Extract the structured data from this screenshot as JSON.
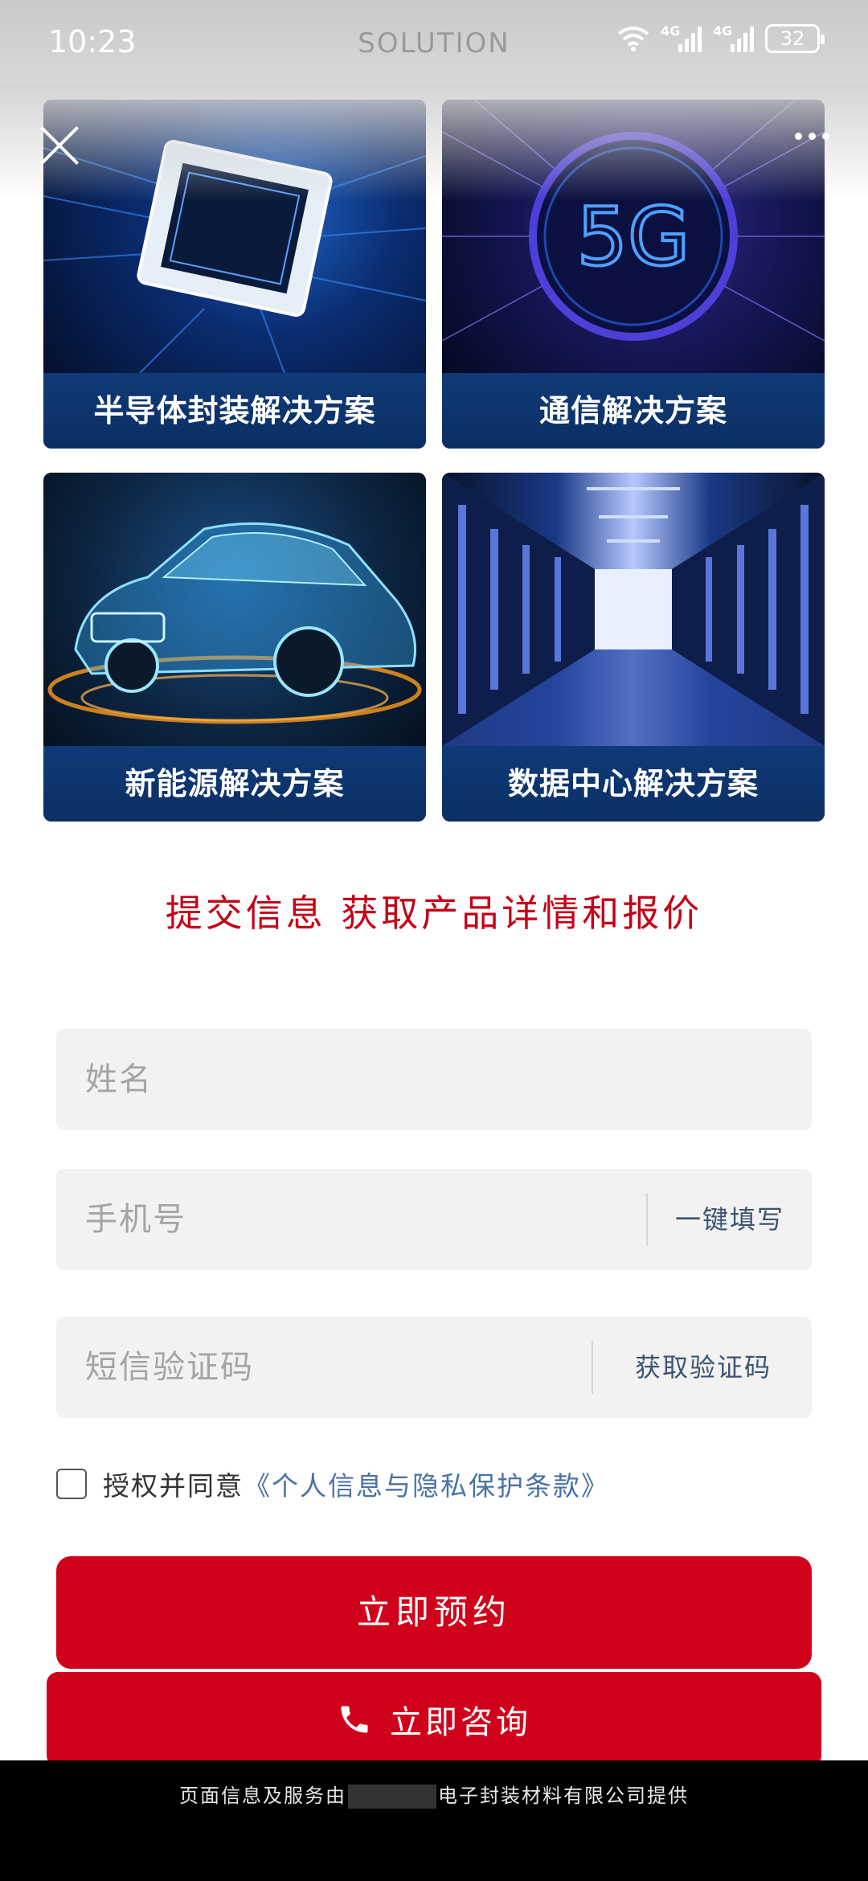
{
  "status_bar": {
    "time": "10:23",
    "center_text": "SOLUTION",
    "network_1": "4G",
    "network_2": "4G",
    "battery": "32"
  },
  "cards": [
    {
      "label": "半导体封装解决方案",
      "image": "semiconductor-chip-image"
    },
    {
      "label": "通信解决方案",
      "image": "5g-image",
      "image_text": "5G"
    },
    {
      "label": "新能源解决方案",
      "image": "car-wireframe-image"
    },
    {
      "label": "数据中心解决方案",
      "image": "data-center-image"
    }
  ],
  "headline": "提交信息 获取产品详情和报价",
  "form": {
    "name_placeholder": "姓名",
    "phone_placeholder": "手机号",
    "autofill_label": "一键填写",
    "sms_placeholder": "短信验证码",
    "get_code_label": "获取验证码",
    "consent_text": "授权并同意",
    "consent_link": "《个人信息与隐私保护条款》",
    "submit_label": "立即预约"
  },
  "consult_button": "立即咨询",
  "footer": {
    "prefix": "页面信息及服务由",
    "suffix": "电子封装材料有限公司提供"
  },
  "colors": {
    "accent_red": "#d0021b",
    "headline_red": "#c40018",
    "card_label_blue": "#0f3a78",
    "link_blue": "#4a72a6"
  }
}
